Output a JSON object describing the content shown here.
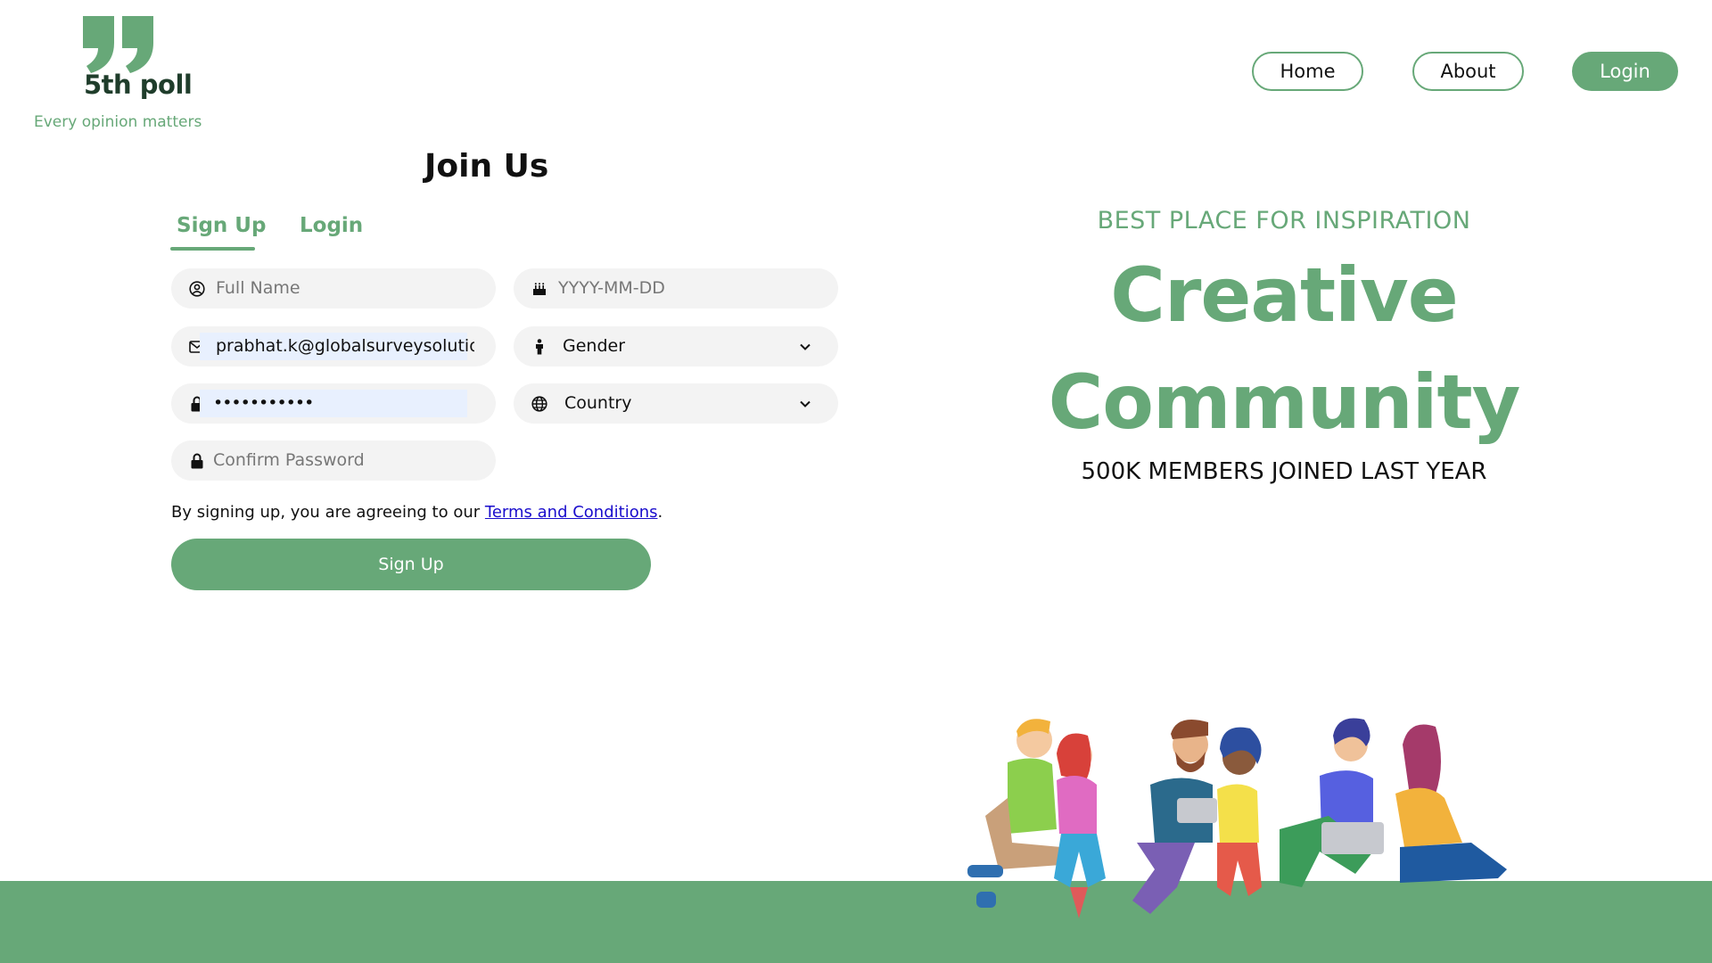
{
  "brand": {
    "name": "5th poll",
    "tagline": "Every opinion matters",
    "color": "#67a878",
    "dark": "#1f3d2b"
  },
  "nav": {
    "home": "Home",
    "about": "About",
    "login": "Login"
  },
  "form": {
    "title": "Join Us",
    "tabs": {
      "signup": "Sign Up",
      "login": "Login",
      "active": "Sign Up"
    },
    "full_name": {
      "placeholder": "Full Name",
      "icon": "user-circle-icon"
    },
    "dob": {
      "placeholder": "YYYY-MM-DD",
      "icon": "cake-icon"
    },
    "email": {
      "value": "prabhat.k@globalsurveysolution",
      "icon": "envelope-icon"
    },
    "gender": {
      "value": "Gender",
      "icon": "person-icon"
    },
    "password": {
      "value": "•••••••••••",
      "icon": "lock-icon"
    },
    "country": {
      "value": "Country",
      "icon": "globe-icon"
    },
    "confirm_password": {
      "placeholder": "Confirm Password",
      "icon": "lock-icon"
    },
    "terms_prefix": "By signing up, you are agreeing to our ",
    "terms_link": "Terms and Conditions",
    "terms_suffix": ".",
    "submit": "Sign Up"
  },
  "hero": {
    "kicker": "BEST PLACE FOR INSPIRATION",
    "line1": "Creative",
    "line2": "Community",
    "members": "500K MEMBERS JOINED LAST YEAR"
  }
}
